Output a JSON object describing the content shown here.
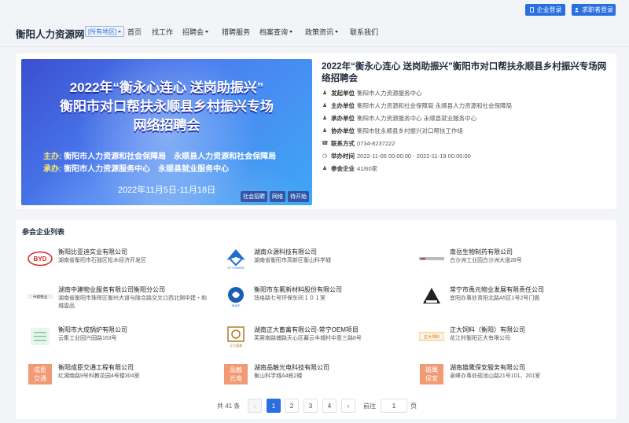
{
  "topbar": {
    "company_login": "企业登录",
    "seeker_login": "求职者登录"
  },
  "nav": {
    "site_name": "衡阳人力资源网",
    "area": "[所有地区]",
    "items": [
      {
        "label": "首页",
        "dropdown": false
      },
      {
        "label": "找工作",
        "dropdown": false
      },
      {
        "label": "招聘会",
        "dropdown": true
      },
      {
        "label": "猎聘服务",
        "dropdown": false
      },
      {
        "label": "档案查询",
        "dropdown": true
      },
      {
        "label": "政策资讯",
        "dropdown": true
      },
      {
        "label": "联系我们",
        "dropdown": false
      }
    ]
  },
  "banner": {
    "line1": "2022年“衡永心连心 送岗助振兴”",
    "line2": "衡阳市对口帮扶永顺县乡村振兴专场",
    "line3": "网络招聘会",
    "host_label": "主办:",
    "host_value": "衡阳市人力资源和社会保障局　永顺县人力资源和社会保障局",
    "org_label": "承办:",
    "org_value": "衡阳市人力资源服务中心　永顺县就业服务中心",
    "date": "2022年11月5日-11月18日",
    "tags": [
      "社会招聘",
      "网络",
      "待开始"
    ]
  },
  "event": {
    "title": "2022年“衡永心连心 送岗助振兴”衡阳市对口帮扶永顺县乡村振兴专场网络招聘会",
    "rows": [
      {
        "icon": "person-icon",
        "label": "发起单位",
        "value": "衡阳市人力资源服务中心"
      },
      {
        "icon": "user-icon",
        "label": "主办单位",
        "value": "衡阳市人力资源和社会保障局 永顺县人力资源和社会保障局"
      },
      {
        "icon": "user-icon",
        "label": "承办单位",
        "value": "衡阳市人力资源服务中心 永顺县就业服务中心"
      },
      {
        "icon": "user-icon",
        "label": "协办单位",
        "value": "衡阳市驻永顺县乡村振兴对口帮扶工作组"
      },
      {
        "icon": "phone-icon",
        "label": "联系方式",
        "value": "0734-8237222"
      },
      {
        "icon": "clock-icon",
        "label": "举办时间",
        "value": "2022-11-05 00:00:00 - 2022-11-19 00:00:00"
      },
      {
        "icon": "users-icon",
        "label": "参会企业",
        "value": "41/60家"
      }
    ]
  },
  "companies": {
    "title": "参会企业列表",
    "items": [
      {
        "name": "衡阳比亚迪实业有限公司",
        "addr": "湖南省衡阳市石鼓区松木经济开发区",
        "logo": "byd",
        "logo_text": "BYD"
      },
      {
        "name": "湖南众源科技有限公司",
        "addr": "湖南省衡阳市高新区衡山科学城",
        "logo": "zy",
        "logo_text": "ZY POWER"
      },
      {
        "name": "南岳生物制药有限公司",
        "addr": "白沙洲工业园白沙洲大道28号",
        "logo": "ny",
        "logo_text": ""
      },
      {
        "name": "湖南中建物业服务有限公司衡阳分公司",
        "addr": "湖南省衡阳市珠晖区衡州大道与陵合路交叉口西北侧中建・和城壹品",
        "logo": "zj",
        "logo_text": "中建物业"
      },
      {
        "name": "衡阳市东氟新材料股份有限公司",
        "addr": "珐珞路七号环保车间１０１室",
        "logo": "df",
        "logo_text": "SHDF"
      },
      {
        "name": "常宁市禹元物业发展有限责任公司",
        "addr": "宜阳办事处青阳北路A5区1号2号门面",
        "logo": "yy",
        "logo_text": ""
      },
      {
        "name": "衡阳市大成锅炉有限公司",
        "addr": "云集工业园兴园路163号",
        "logo": "dc",
        "logo_text": ""
      },
      {
        "name": "湖南正大畜禽有限公司-常宁OEM项目",
        "addr": "芙蓉南路辅路天心区暮云丰城村中意三路8号",
        "logo": "zd",
        "logo_text": "正大畜禽"
      },
      {
        "name": "正大饲料（衡阳）有限公司",
        "addr": "花江村衡阳正大有限公司",
        "logo": "zdsl",
        "logo_text": "正大饲料"
      },
      {
        "name": "衡阳成臣交通工程有限公司",
        "addr": "红湘南路9号科教花园4号楼304室",
        "logo": "tile",
        "logo_text": "成臣交通",
        "color": "#f29a73"
      },
      {
        "name": "湖南品触光电科技有限公司",
        "addr": "衡山科学城A4栋2楼",
        "logo": "tile",
        "logo_text": "品触光电",
        "color": "#f29a73"
      },
      {
        "name": "湖南雄鹰保安服务有限公司",
        "addr": "泉峰办事处砚池山路21号101、201室",
        "logo": "tile",
        "logo_text": "雄鹰保安",
        "color": "#f29a73"
      }
    ]
  },
  "pagination": {
    "total": "共 41 条",
    "pages": [
      "1",
      "2",
      "3",
      "4"
    ],
    "current": "1",
    "goto_label": "前往",
    "goto_value": "1",
    "page_label": "页"
  }
}
